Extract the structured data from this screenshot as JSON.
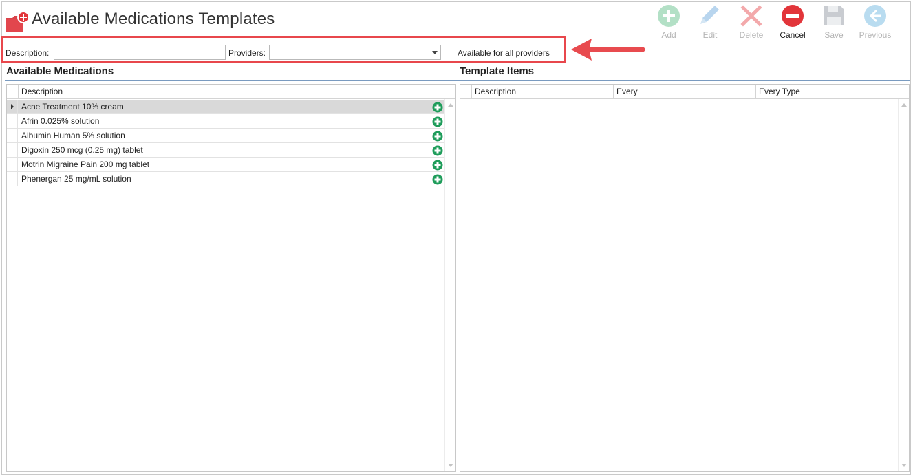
{
  "page": {
    "title": "Available Medications Templates"
  },
  "toolbar": {
    "buttons": [
      {
        "label": "Add",
        "icon": "add-icon",
        "enabled": false
      },
      {
        "label": "Edit",
        "icon": "pencil-icon",
        "enabled": false
      },
      {
        "label": "Delete",
        "icon": "delete-x-icon",
        "enabled": false
      },
      {
        "label": "Cancel",
        "icon": "cancel-icon",
        "enabled": true
      },
      {
        "label": "Save",
        "icon": "floppy-disk-icon",
        "enabled": false
      },
      {
        "label": "Previous",
        "icon": "back-arrow-icon",
        "enabled": false
      }
    ]
  },
  "filters": {
    "description_label": "Description:",
    "description_value": "",
    "providers_label": "Providers:",
    "providers_value": "",
    "all_providers_label": "Available for all providers",
    "all_providers_checked": false
  },
  "available_medications": {
    "title": "Available Medications",
    "columns": [
      "Description"
    ],
    "rows": [
      {
        "description": "Acne Treatment 10% cream",
        "selected": true
      },
      {
        "description": "Afrin 0.025% solution",
        "selected": false
      },
      {
        "description": "Albumin Human 5% solution",
        "selected": false
      },
      {
        "description": "Digoxin 250 mcg (0.25 mg) tablet",
        "selected": false
      },
      {
        "description": "Motrin Migraine Pain 200 mg tablet",
        "selected": false
      },
      {
        "description": "Phenergan 25 mg/mL solution",
        "selected": false
      }
    ]
  },
  "template_items": {
    "title": "Template Items",
    "columns": [
      "Description",
      "Every",
      "Every Type"
    ],
    "rows": []
  },
  "colors": {
    "highlight_border": "#e8474c",
    "add_green": "#1e9c5a",
    "cancel_red": "#e2353a",
    "divider_blue": "#7a9bc0",
    "selected_row": "#d9d9d9"
  }
}
